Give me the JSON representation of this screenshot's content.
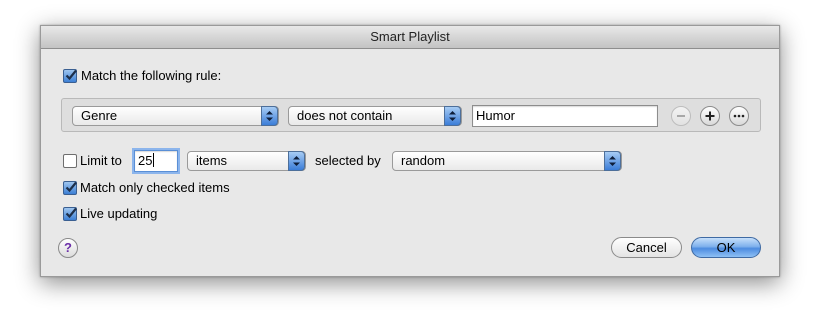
{
  "window": {
    "title": "Smart Playlist"
  },
  "match_rule": {
    "label": "Match the following rule:",
    "checked": true
  },
  "rule": {
    "field": "Genre",
    "operator": "does not contain",
    "value": "Humor"
  },
  "limit": {
    "label": "Limit to",
    "checked": false,
    "count": "25",
    "unit": "items",
    "selected_by_label": "selected by",
    "selected_by": "random"
  },
  "match_checked": {
    "label": "Match only checked items",
    "checked": true
  },
  "live_updating": {
    "label": "Live updating",
    "checked": true
  },
  "buttons": {
    "help": "?",
    "cancel": "Cancel",
    "ok": "OK"
  },
  "icons": {
    "remove_rule": "minus-circle-icon",
    "add_rule": "plus-circle-icon",
    "more_rules": "ellipsis-circle-icon",
    "popup_arrows": "updown-arrows-icon",
    "checkmark": "checkmark-icon"
  },
  "colors": {
    "accent": "#3c7fd5",
    "help": "#6b2fa8"
  }
}
